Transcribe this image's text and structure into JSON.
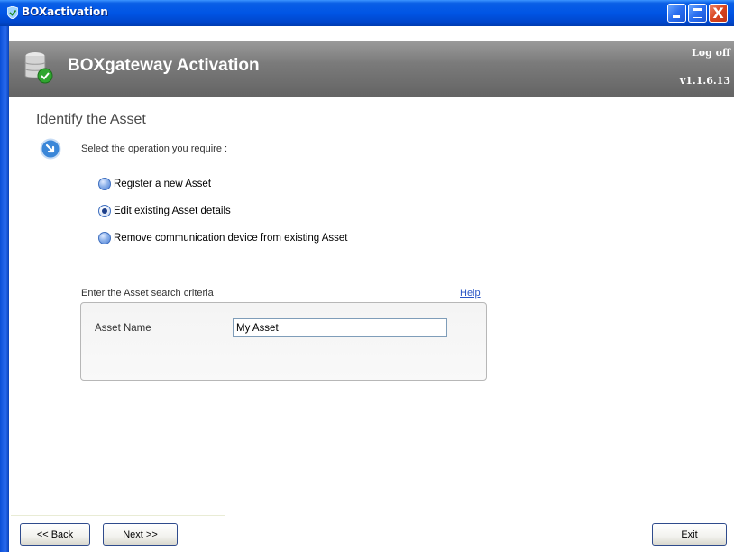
{
  "window": {
    "title": "BOXactivation",
    "close_glyph": "X"
  },
  "header": {
    "title": "BOXgateway Activation",
    "logoff": "Log off",
    "version": "v1.1.6.13"
  },
  "page": {
    "title": "Identify the Asset",
    "instruction": "Select the operation you require :",
    "options": [
      {
        "label": "Register a new Asset",
        "checked": false
      },
      {
        "label": "Edit existing Asset details",
        "checked": true
      },
      {
        "label": "Remove communication device from existing Asset",
        "checked": false
      }
    ]
  },
  "search": {
    "label": "Enter the Asset search criteria",
    "help": "Help",
    "field_label": "Asset Name",
    "field_value": "My Asset"
  },
  "buttons": {
    "back": "<< Back",
    "next": "Next >>",
    "exit": "Exit"
  },
  "colors": {
    "titlebar": "#0055e5",
    "header": "#7b7b7b",
    "link": "#2a56c6"
  },
  "icons": {
    "app": "shield-icon",
    "header": "database-check-icon",
    "step": "arrow-circle-icon"
  }
}
